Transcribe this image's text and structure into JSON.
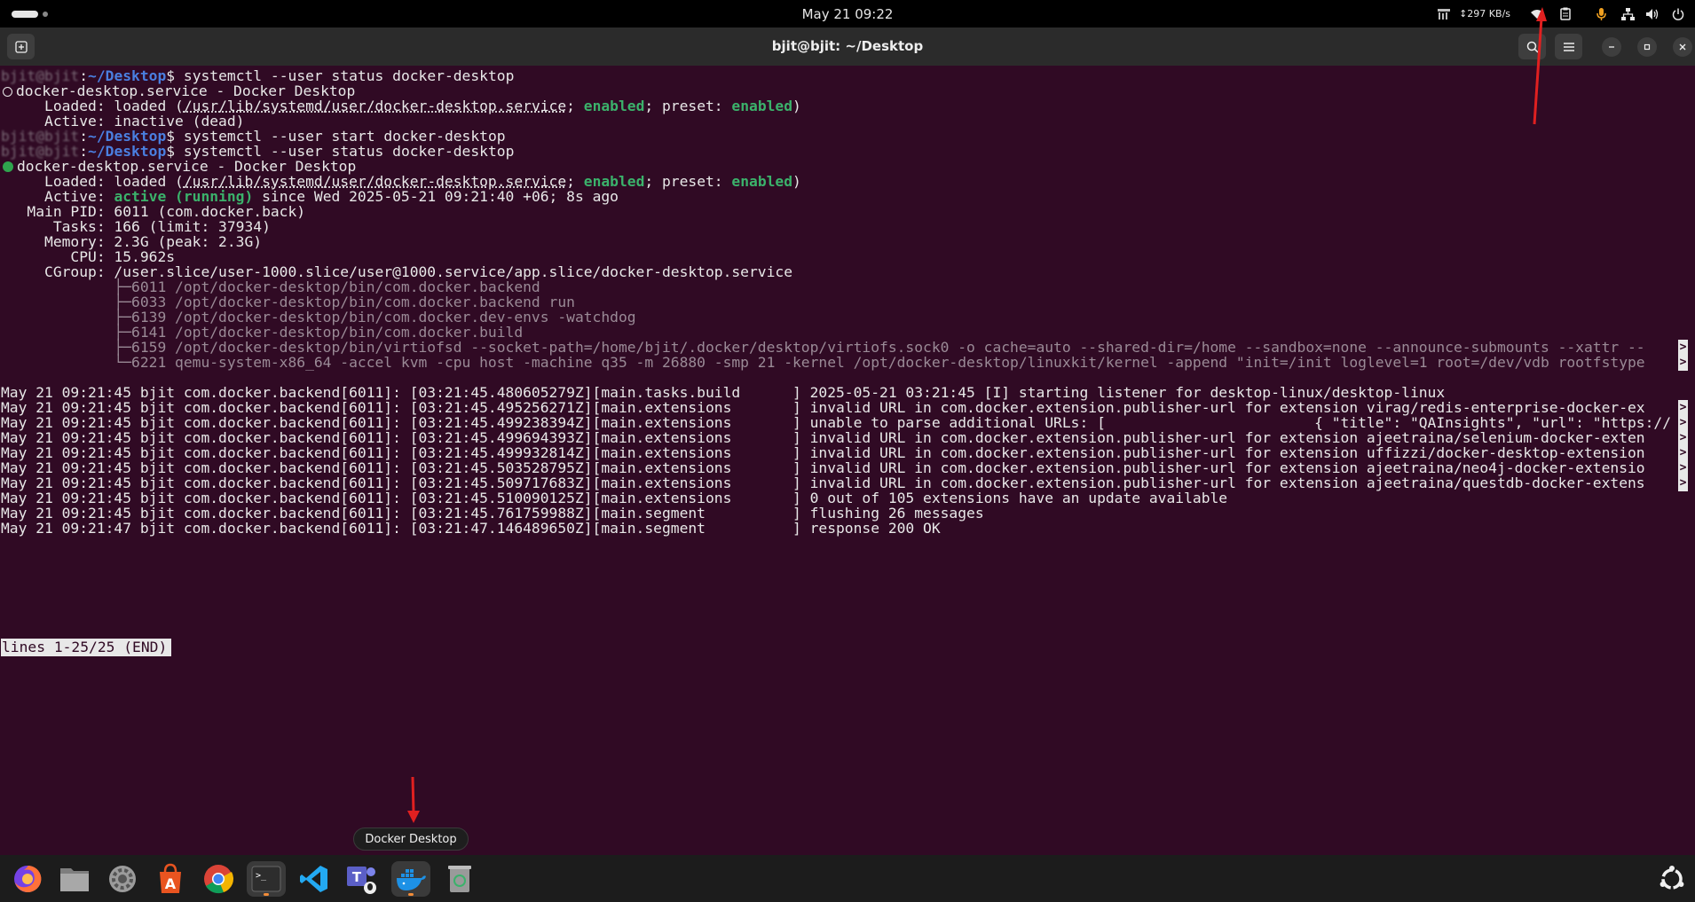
{
  "topbar": {
    "datetime": "May 21  09:22",
    "net_speed": "↕297 KB/s",
    "icons": [
      "cpu-monitor-icon",
      "wifi-icon",
      "clipboard-icon",
      "microphone-icon",
      "network-icon",
      "volume-icon",
      "power-icon"
    ]
  },
  "window": {
    "title": "bjit@bjit: ~/Desktop"
  },
  "terminal": {
    "lines": [
      {
        "prefix": "bjit@bjit",
        "path": "~/Desktop",
        "cmd": "systemctl --user status docker-desktop"
      },
      {
        "unit": "docker-desktop.service - Docker Desktop",
        "state": "inactive"
      },
      {
        "loaded_a": "     Loaded: loaded (",
        "loaded_path": "/usr/lib/systemd/user/docker-desktop.service",
        "loaded_b": "; ",
        "enabled": "enabled",
        "loaded_c": "; preset: ",
        "preset": "enabled",
        "loaded_d": ")"
      },
      {
        "text": "     Active: inactive (dead)"
      },
      {
        "prefix": "bjit@bjit",
        "path": "~/Desktop",
        "cmd": "systemctl --user start docker-desktop"
      },
      {
        "prefix": "bjit@bjit",
        "path": "~/Desktop",
        "cmd": "systemctl --user status docker-desktop"
      },
      {
        "unit": "docker-desktop.service - Docker Desktop",
        "state": "active"
      },
      {
        "loaded_a": "     Loaded: loaded (",
        "loaded_path": "/usr/lib/systemd/user/docker-desktop.service",
        "loaded_b": "; ",
        "enabled": "enabled",
        "loaded_c": "; preset: ",
        "preset": "enabled",
        "loaded_d": ")"
      },
      {
        "active_a": "     Active: ",
        "active_b": "active (running)",
        "active_c": " since Wed 2025-05-21 09:21:40 +06; 8s ago"
      },
      {
        "text": "   Main PID: 6011 (com.docker.back)"
      },
      {
        "text": "      Tasks: 166 (limit: 37934)"
      },
      {
        "text": "     Memory: 2.3G (peak: 2.3G)"
      },
      {
        "text": "        CPU: 15.962s"
      },
      {
        "text": "     CGroup: /user.slice/user-1000.slice/user@1000.service/app.slice/docker-desktop.service"
      },
      {
        "tree": "             ├─6011 /opt/docker-desktop/bin/com.docker.backend"
      },
      {
        "tree": "             ├─6033 /opt/docker-desktop/bin/com.docker.backend run"
      },
      {
        "tree": "             ├─6139 /opt/docker-desktop/bin/com.docker.dev-envs -watchdog"
      },
      {
        "tree": "             ├─6141 /opt/docker-desktop/bin/com.docker.build"
      },
      {
        "tree": "             ├─6159 /opt/docker-desktop/bin/virtiofsd --socket-path=/home/bjit/.docker/desktop/virtiofs.sock0 -o cache=auto --shared-dir=/home --sandbox=none --announce-submounts --xattr --",
        "truncated": true
      },
      {
        "tree": "             └─6221 qemu-system-x86_64 -accel kvm -cpu host -machine q35 -m 26880 -smp 21 -kernel /opt/docker-desktop/linuxkit/kernel -append \"init=/init loglevel=1 root=/dev/vdb rootfstype",
        "truncated": true
      },
      {
        "text": ""
      },
      {
        "text": "May 21 09:21:45 bjit com.docker.backend[6011]: [03:21:45.480605279Z][main.tasks.build      ] 2025-05-21 03:21:45 [I] starting listener for desktop-linux/desktop-linux"
      },
      {
        "text": "May 21 09:21:45 bjit com.docker.backend[6011]: [03:21:45.495256271Z][main.extensions       ] invalid URL in com.docker.extension.publisher-url for extension virag/redis-enterprise-docker-ex",
        "truncated": true
      },
      {
        "text": "May 21 09:21:45 bjit com.docker.backend[6011]: [03:21:45.499238394Z][main.extensions       ] unable to parse additional URLs: [                        { \"title\": \"QAInsights\", \"url\": \"https://",
        "truncated": true
      },
      {
        "text": "May 21 09:21:45 bjit com.docker.backend[6011]: [03:21:45.499694393Z][main.extensions       ] invalid URL in com.docker.extension.publisher-url for extension ajeetraina/selenium-docker-exten",
        "truncated": true
      },
      {
        "text": "May 21 09:21:45 bjit com.docker.backend[6011]: [03:21:45.499932814Z][main.extensions       ] invalid URL in com.docker.extension.publisher-url for extension uffizzi/docker-desktop-extension",
        "truncated": true
      },
      {
        "text": "May 21 09:21:45 bjit com.docker.backend[6011]: [03:21:45.503528795Z][main.extensions       ] invalid URL in com.docker.extension.publisher-url for extension ajeetraina/neo4j-docker-extensio",
        "truncated": true
      },
      {
        "text": "May 21 09:21:45 bjit com.docker.backend[6011]: [03:21:45.509717683Z][main.extensions       ] invalid URL in com.docker.extension.publisher-url for extension ajeetraina/questdb-docker-extens",
        "truncated": true
      },
      {
        "text": "May 21 09:21:45 bjit com.docker.backend[6011]: [03:21:45.510090125Z][main.extensions       ] 0 out of 105 extensions have an update available"
      },
      {
        "text": "May 21 09:21:45 bjit com.docker.backend[6011]: [03:21:45.761759988Z][main.segment          ] flushing 26 messages"
      },
      {
        "text": "May 21 09:21:47 bjit com.docker.backend[6011]: [03:21:47.146489650Z][main.segment          ] response 200 OK"
      }
    ],
    "pager_status": "lines 1-25/25 (END)",
    "continuation_glyph": ">"
  },
  "dock": {
    "tooltip": "Docker Desktop",
    "apps": [
      {
        "name": "firefox-icon"
      },
      {
        "name": "files-icon"
      },
      {
        "name": "settings-icon"
      },
      {
        "name": "app-center-icon"
      },
      {
        "name": "chrome-icon"
      },
      {
        "name": "terminal-icon",
        "active": true
      },
      {
        "name": "vscode-icon"
      },
      {
        "name": "teams-icon"
      },
      {
        "name": "docker-icon",
        "active": true
      },
      {
        "name": "trash-icon"
      }
    ],
    "show_apps_icon": "ubuntu-logo-icon"
  },
  "colors": {
    "terminal_bg": "#300a24",
    "path_blue": "#4a7fe0",
    "status_green": "#3bb26b",
    "annotation_red": "#e02020"
  }
}
